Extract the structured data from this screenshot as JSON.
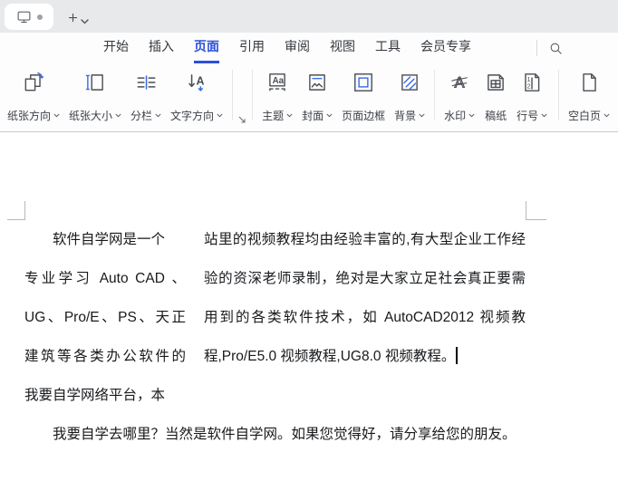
{
  "colors": {
    "accent_blue": "#2c50d9",
    "icon_blue": "#3b6ce1",
    "tabbar_bg": "#e7e9eb",
    "ribbon_border": "#c9cbce",
    "document_text": "#17191c"
  },
  "menubar": {
    "tabs": [
      {
        "label": "开始",
        "active": false
      },
      {
        "label": "插入",
        "active": false
      },
      {
        "label": "页面",
        "active": true
      },
      {
        "label": "引用",
        "active": false
      },
      {
        "label": "审阅",
        "active": false
      },
      {
        "label": "视图",
        "active": false
      },
      {
        "label": "工具",
        "active": false
      },
      {
        "label": "会员专享",
        "active": false
      }
    ]
  },
  "toolbar": {
    "buttons": [
      {
        "label": "纸张方向",
        "dropdown": true,
        "icon": "paper-orientation-icon"
      },
      {
        "label": "纸张大小",
        "dropdown": true,
        "icon": "paper-size-icon"
      },
      {
        "label": "分栏",
        "dropdown": true,
        "icon": "columns-icon"
      },
      {
        "label": "文字方向",
        "dropdown": true,
        "icon": "text-direction-icon"
      },
      {
        "label": "主题",
        "dropdown": true,
        "icon": "theme-icon"
      },
      {
        "label": "封面",
        "dropdown": true,
        "icon": "cover-page-icon"
      },
      {
        "label": "页面边框",
        "dropdown": false,
        "icon": "page-border-icon"
      },
      {
        "label": "背景",
        "dropdown": true,
        "icon": "background-icon"
      },
      {
        "label": "水印",
        "dropdown": true,
        "icon": "watermark-icon"
      },
      {
        "label": "稿纸",
        "dropdown": false,
        "icon": "manuscript-grid-icon"
      },
      {
        "label": "行号",
        "dropdown": true,
        "icon": "line-number-icon"
      },
      {
        "label": "空白页",
        "dropdown": true,
        "icon": "blank-page-icon"
      }
    ]
  },
  "document": {
    "left_column_lines": [
      "软件自学网是一个",
      "专业学习 Auto CAD 、",
      "UG、Pro/E、PS、天正",
      "建筑等各类办公软件的",
      "我要自学网络平台，本"
    ],
    "right_column_lines": [
      "站里的视频教程均由经验丰富的,有大型企业工作经",
      "验的资深老师录制，绝对是大家立足社会真正要需",
      "用到的各类软件技术，如 AutoCAD2012 视频教",
      "程,Pro/E5.0 视频教程,UG8.0 视频教程。"
    ],
    "closing_paragraph": "我要自学去哪里？当然是软件自学网。如果您觉得好，请分享给您的朋友。"
  }
}
